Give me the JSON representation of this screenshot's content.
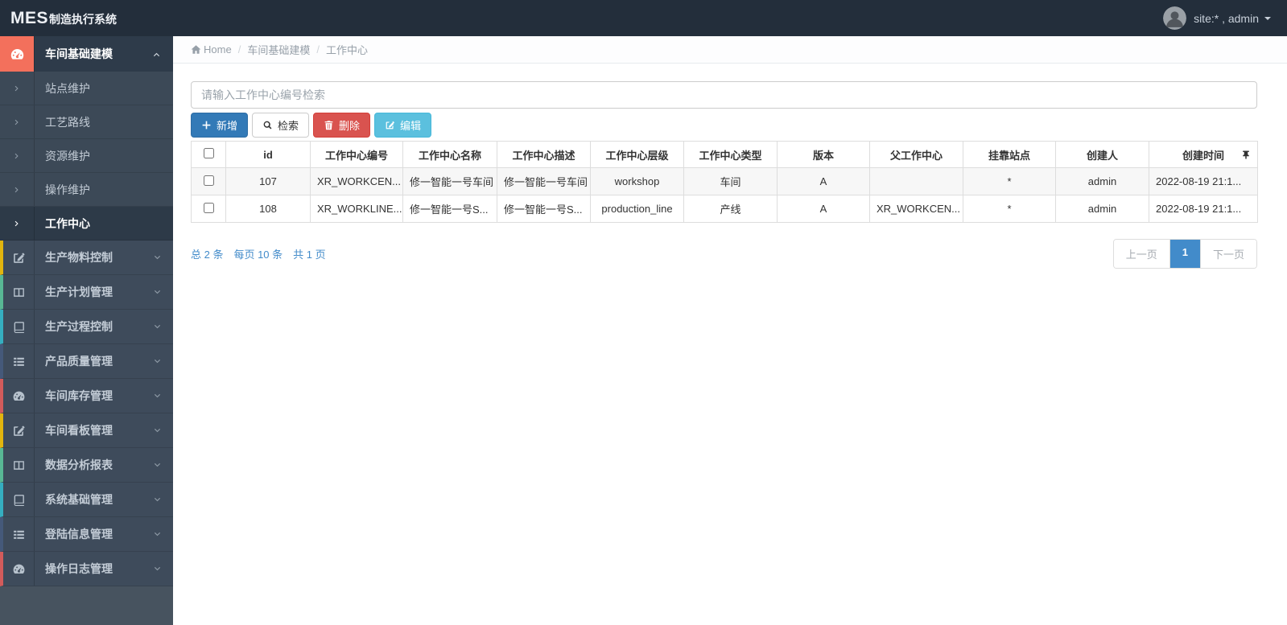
{
  "app": {
    "brand_bold": "MES",
    "brand_rest": "制造执行系统",
    "user_label": "site:* , admin"
  },
  "colors": {
    "navbar": "#232e3b",
    "sidebar": "#3e4b5b",
    "accent_salmon": "#f3705c",
    "primary": "#337ab7",
    "danger": "#d9534f",
    "info": "#5bc0de",
    "link_blue": "#428bca"
  },
  "sidebar": {
    "parent": {
      "label": "车间基础建模",
      "icon": "gauge-icon",
      "state_icon": "chevron-up-icon"
    },
    "submenu": [
      {
        "label": "站点维护",
        "active": false
      },
      {
        "label": "工艺路线",
        "active": false
      },
      {
        "label": "资源维护",
        "active": false
      },
      {
        "label": "操作维护",
        "active": false
      },
      {
        "label": "工作中心",
        "active": true
      }
    ],
    "sections": [
      {
        "label": "生产物料控制",
        "icon": "edit-icon",
        "strip": "#e2b50e"
      },
      {
        "label": "生产计划管理",
        "icon": "columns-icon",
        "strip": "#58b794"
      },
      {
        "label": "生产过程控制",
        "icon": "book-icon",
        "strip": "#35aec0"
      },
      {
        "label": "产品质量管理",
        "icon": "list-icon",
        "strip": "#45597a"
      },
      {
        "label": "车间库存管理",
        "icon": "gauge-icon",
        "strip": "#d25b5b"
      },
      {
        "label": "车间看板管理",
        "icon": "edit-icon",
        "strip": "#e2b50e"
      },
      {
        "label": "数据分析报表",
        "icon": "columns-icon",
        "strip": "#58b794"
      },
      {
        "label": "系统基础管理",
        "icon": "book-icon",
        "strip": "#35aec0"
      },
      {
        "label": "登陆信息管理",
        "icon": "list-icon",
        "strip": "#45597a"
      },
      {
        "label": "操作日志管理",
        "icon": "gauge-icon",
        "strip": "#d25b5b"
      }
    ]
  },
  "breadcrumb": {
    "items": [
      "Home",
      "车间基础建模",
      "工作中心"
    ]
  },
  "search": {
    "placeholder": "请输入工作中心编号检索",
    "value": ""
  },
  "toolbar": {
    "add": "新增",
    "search": "检索",
    "delete": "删除",
    "edit": "编辑"
  },
  "table": {
    "headers": [
      "id",
      "工作中心编号",
      "工作中心名称",
      "工作中心描述",
      "工作中心层级",
      "工作中心类型",
      "版本",
      "父工作中心",
      "挂靠站点",
      "创建人",
      "创建时间"
    ],
    "pin_icon": "pushpin-icon",
    "rows": [
      {
        "checked": false,
        "cells": [
          "107",
          "XR_WORKCEN...",
          "修一智能一号车间",
          "修一智能一号车间",
          "workshop",
          "车间",
          "A",
          "",
          "*",
          "admin",
          "2022-08-19 21:1..."
        ]
      },
      {
        "checked": false,
        "cells": [
          "108",
          "XR_WORKLINE...",
          "修一智能一号S...",
          "修一智能一号S...",
          "production_line",
          "产线",
          "A",
          "XR_WORKCEN...",
          "*",
          "admin",
          "2022-08-19 21:1..."
        ]
      }
    ]
  },
  "pagination": {
    "summary_total": "总 2 条",
    "summary_per_page": "每页 10 条",
    "summary_pages": "共 1 页",
    "prev": "上一页",
    "page": "1",
    "next": "下一页"
  }
}
